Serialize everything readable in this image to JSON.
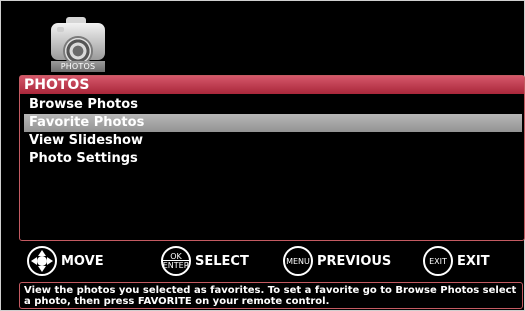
{
  "app_icon": {
    "icon": "camera-icon",
    "label": "PHOTOS"
  },
  "menu": {
    "title": "PHOTOS",
    "items": [
      {
        "label": "Browse Photos",
        "selected": false
      },
      {
        "label": "Favorite Photos",
        "selected": true
      },
      {
        "label": "View Slideshow",
        "selected": false
      },
      {
        "label": "Photo Settings",
        "selected": false
      }
    ]
  },
  "controls": {
    "move": {
      "icon": "dpad-icon",
      "label": "MOVE"
    },
    "select": {
      "icon_text_top": "OK",
      "icon_text_bottom": "ENTER",
      "label": "SELECT"
    },
    "previous": {
      "icon_text": "MENU",
      "label": "PREVIOUS"
    },
    "exit": {
      "icon_text": "EXIT",
      "label": "EXIT"
    }
  },
  "description": "View the photos you selected as favorites. To set a favorite go to Browse Photos select a photo, then press FAVORITE on your remote control.",
  "colors": {
    "background": "#000000",
    "accent": "#b83246",
    "selection": "#a6a6a6",
    "text": "#ffffff"
  }
}
